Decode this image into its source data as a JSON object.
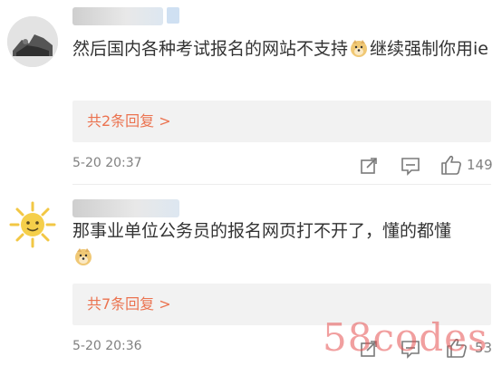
{
  "comments": [
    {
      "text_before": "然后国内各种考试报名的网站不支持",
      "text_after": "继续强制你用ie",
      "replies_label": "共2条回复 >",
      "time": "5-20 20:37",
      "likes": "149"
    },
    {
      "text_before": "那事业单位公务员的报名网页打不开了，懂的都懂",
      "text_after": "",
      "replies_label": "共7条回复 >",
      "time": "5-20 20:36",
      "likes": "53"
    }
  ],
  "watermark": "58codes",
  "colors": {
    "accent": "#eb7350",
    "muted": "#808080",
    "reply_bg": "#f2f2f2"
  },
  "icons": [
    "share-icon",
    "comment-icon",
    "like-icon",
    "doge-emoji",
    "sun-avatar"
  ]
}
